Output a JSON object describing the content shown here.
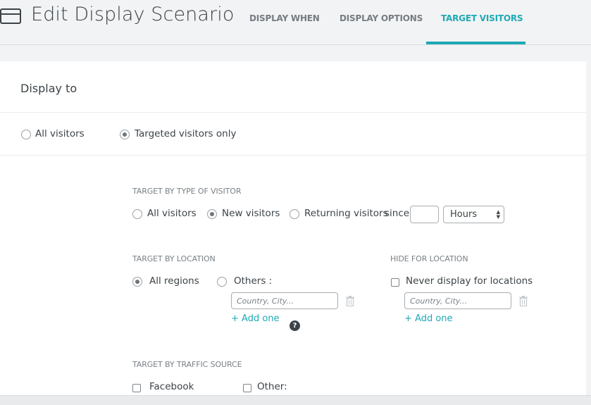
{
  "header": {
    "title": "Edit Display Scenario",
    "icon": "window-icon",
    "tabs": [
      {
        "label": "DISPLAY WHEN",
        "active": false
      },
      {
        "label": "DISPLAY OPTIONS",
        "active": false
      },
      {
        "label": "TARGET VISITORS",
        "active": true
      }
    ],
    "accent_color": "#1fa9b5"
  },
  "display_to": {
    "title": "Display to",
    "options": [
      {
        "label": "All visitors",
        "checked": false
      },
      {
        "label": "Targeted visitors only",
        "checked": true
      }
    ]
  },
  "type_of_visitor": {
    "heading": "TARGET BY TYPE OF VISITOR",
    "options": [
      {
        "label": "All visitors",
        "checked": false
      },
      {
        "label": "New visitors",
        "checked": true
      },
      {
        "label": "Returning visitors",
        "checked": false
      }
    ],
    "since_label": "since",
    "since_value": "",
    "unit_selected": "Hours"
  },
  "location": {
    "heading": "TARGET BY LOCATION",
    "options": [
      {
        "label": "All regions",
        "checked": true
      },
      {
        "label": "Others :",
        "checked": false
      }
    ],
    "input_placeholder": "Country, City...",
    "add_label": "+ Add one"
  },
  "hide_location": {
    "heading": "HIDE FOR LOCATION",
    "checkbox_label": "Never display for locations",
    "checked": false,
    "input_placeholder": "Country, City...",
    "add_label": "+ Add one"
  },
  "traffic_source": {
    "heading": "TARGET BY TRAFFIC SOURCE",
    "options": [
      {
        "label": "Facebook",
        "checked": false
      },
      {
        "label": "Other:",
        "checked": false
      }
    ],
    "help_glyph": "?"
  }
}
